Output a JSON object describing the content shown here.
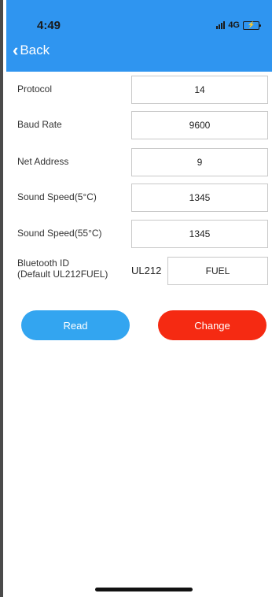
{
  "status_bar": {
    "time": "4:49",
    "network": "4G",
    "battery_icon": "battery-charging-icon",
    "signal_icon": "signal-bars-icon"
  },
  "nav": {
    "back_label": "Back",
    "back_icon": "chevron-left-icon"
  },
  "form": {
    "rows": [
      {
        "label": "Protocol",
        "value": "14"
      },
      {
        "label": "Baud Rate",
        "value": "9600"
      },
      {
        "label": "Net Address",
        "value": "9"
      },
      {
        "label": "Sound Speed(5°C)",
        "value": "1345"
      },
      {
        "label": "Sound Speed(55°C)",
        "value": "1345"
      }
    ],
    "bluetooth": {
      "label_line1": "Bluetooth ID",
      "label_line2": "(Default UL212FUEL)",
      "prefix": "UL212",
      "value": "FUEL"
    }
  },
  "actions": {
    "read_label": "Read",
    "change_label": "Change"
  },
  "colors": {
    "header": "#2f95f0",
    "read": "#33a5f0",
    "change": "#f52a12"
  }
}
